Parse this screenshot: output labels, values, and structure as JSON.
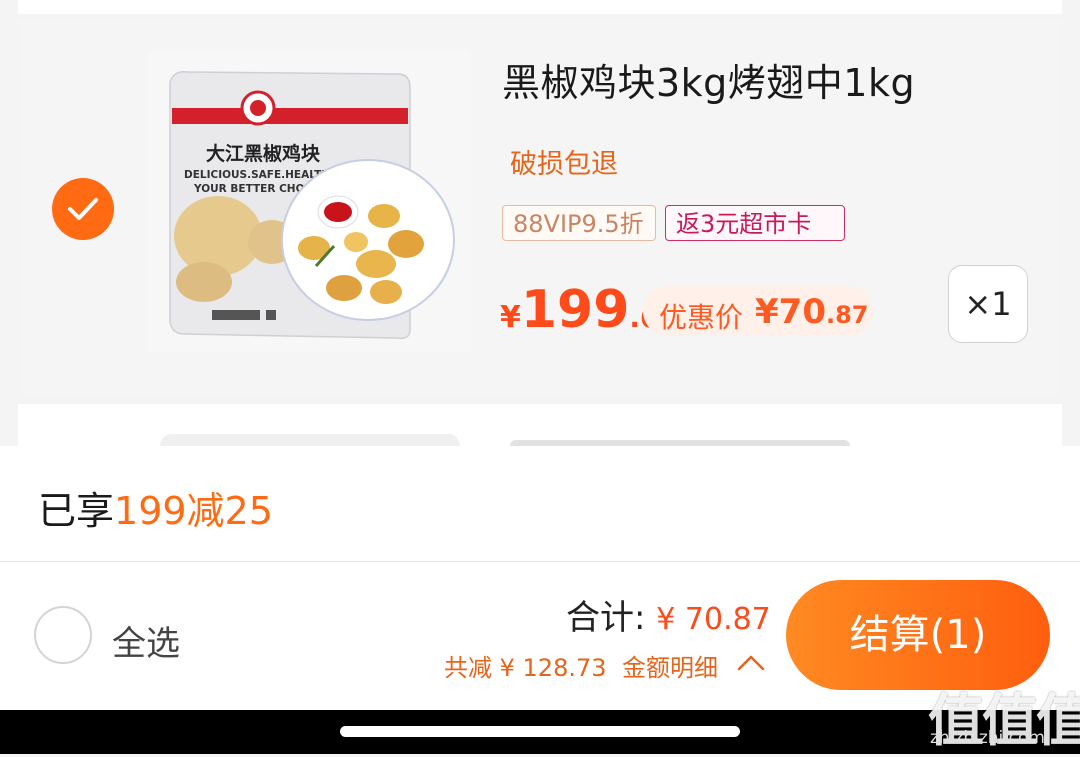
{
  "product": {
    "title": "黑椒鸡块3kg烤翅中1kg",
    "service_tag": "破损包退",
    "tags": [
      "88VIP9.5折",
      "返3元超市卡"
    ],
    "price": {
      "yen": "¥",
      "integer": "199",
      "decimal": ".6"
    },
    "promo": {
      "label": "优惠价",
      "value_main": "¥70",
      "value_decimal": ".87"
    },
    "quantity": "×1",
    "selected": true,
    "image": {
      "brand_text": "大江黑椒鸡块",
      "slogan_line1": "DELICIOUS.SAFE.HEALTHY",
      "slogan_line2": "YOUR BETTER CHOICE"
    }
  },
  "summary": {
    "enjoyed_prefix": "已享",
    "enjoyed_highlight": "199减25"
  },
  "footer": {
    "select_all": "全选",
    "total_label": "合计: ",
    "total_amount": "¥ 70.87",
    "saved": "共减 ¥ 128.73",
    "detail": "金额明细",
    "checkout": "结算(1)"
  },
  "watermark": {
    "main": "值值值",
    "sub": "zhizhizhi.com"
  },
  "colors": {
    "accent": "#ff6a13",
    "price": "#ff4a1a",
    "tag_pink": "#c61a5c"
  }
}
